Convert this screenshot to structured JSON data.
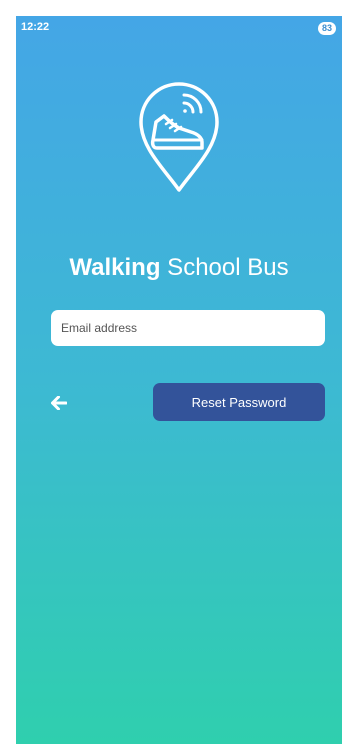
{
  "status_bar": {
    "time": "12:22",
    "battery": "83"
  },
  "logo": {
    "icon": "walking-shoe-location-pin-icon"
  },
  "title": {
    "bold": "Walking",
    "regular": " School Bus"
  },
  "form": {
    "email_placeholder": "Email address",
    "email_value": ""
  },
  "actions": {
    "back_icon": "arrow-left-icon",
    "reset_label": "Reset Password"
  },
  "colors": {
    "gradient_top": "#44a6e6",
    "gradient_bottom": "#2fcfae",
    "button": "#33539a"
  }
}
